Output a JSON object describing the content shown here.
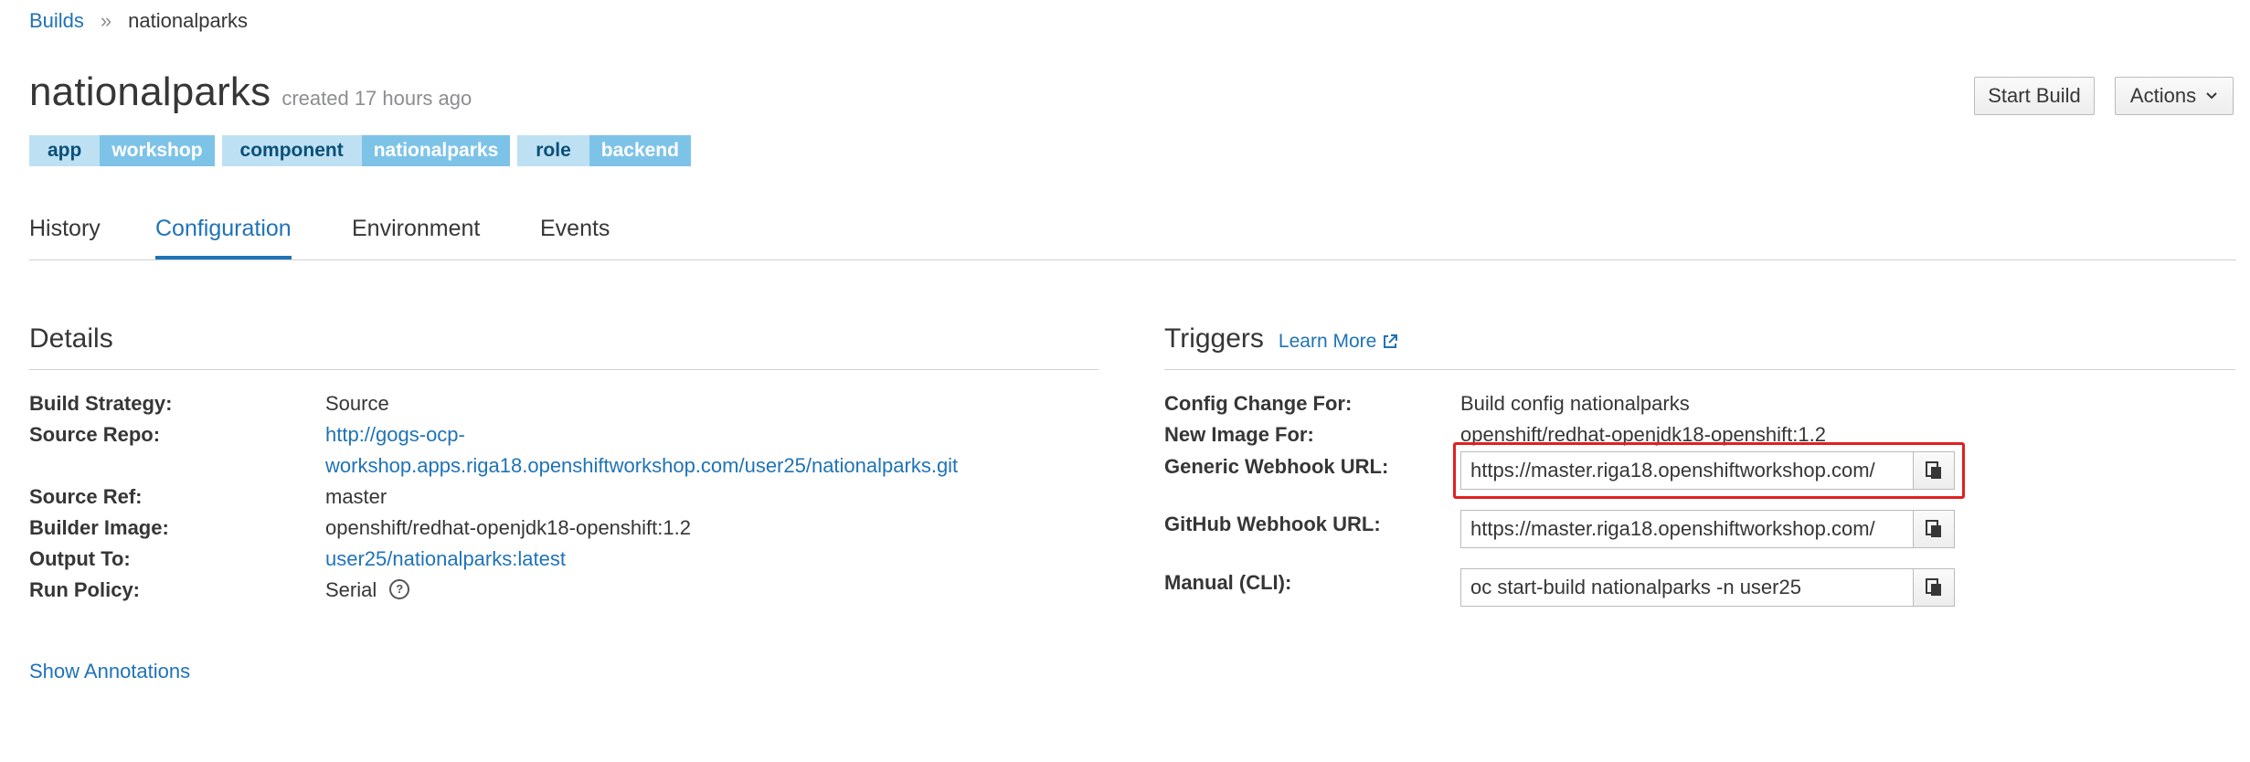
{
  "breadcrumb": {
    "parent": "Builds",
    "separator": "»",
    "current": "nationalparks"
  },
  "header": {
    "title": "nationalparks",
    "created": "created 17 hours ago"
  },
  "labels": [
    {
      "key": "app",
      "value": "workshop"
    },
    {
      "key": "component",
      "value": "nationalparks"
    },
    {
      "key": "role",
      "value": "backend"
    }
  ],
  "actions": {
    "start_build": "Start Build",
    "actions": "Actions"
  },
  "tabs": [
    {
      "label": "History"
    },
    {
      "label": "Configuration",
      "active": true
    },
    {
      "label": "Environment"
    },
    {
      "label": "Events"
    }
  ],
  "details": {
    "title": "Details",
    "build_strategy_label": "Build Strategy:",
    "build_strategy": "Source",
    "source_repo_label": "Source Repo:",
    "source_repo_line1": "http://gogs-ocp-",
    "source_repo_line2": "workshop.apps.riga18.openshiftworkshop.com/user25/nationalparks.git",
    "source_ref_label": "Source Ref:",
    "source_ref": "master",
    "builder_image_label": "Builder Image:",
    "builder_image": "openshift/redhat-openjdk18-openshift:1.2",
    "output_to_label": "Output To:",
    "output_to": "user25/nationalparks:latest",
    "run_policy_label": "Run Policy:",
    "run_policy": "Serial",
    "show_annotations": "Show Annotations"
  },
  "triggers": {
    "title": "Triggers",
    "learn_more": "Learn More",
    "config_change_label": "Config Change For:",
    "config_change": "Build config nationalparks",
    "new_image_label": "New Image For:",
    "new_image": "openshift/redhat-openjdk18-openshift:1.2",
    "generic_webhook_label": "Generic Webhook URL:",
    "generic_webhook": "https://master.riga18.openshiftworkshop.com/",
    "github_webhook_label": "GitHub Webhook URL:",
    "github_webhook": "https://master.riga18.openshiftworkshop.com/",
    "manual_label": "Manual (CLI):",
    "manual": "oc start-build nationalparks -n user25"
  },
  "colors": {
    "link": "#1f73b7",
    "label_key_bg": "#bde1f3",
    "label_value_bg": "#7dc3e8",
    "highlight": "#e02020"
  }
}
